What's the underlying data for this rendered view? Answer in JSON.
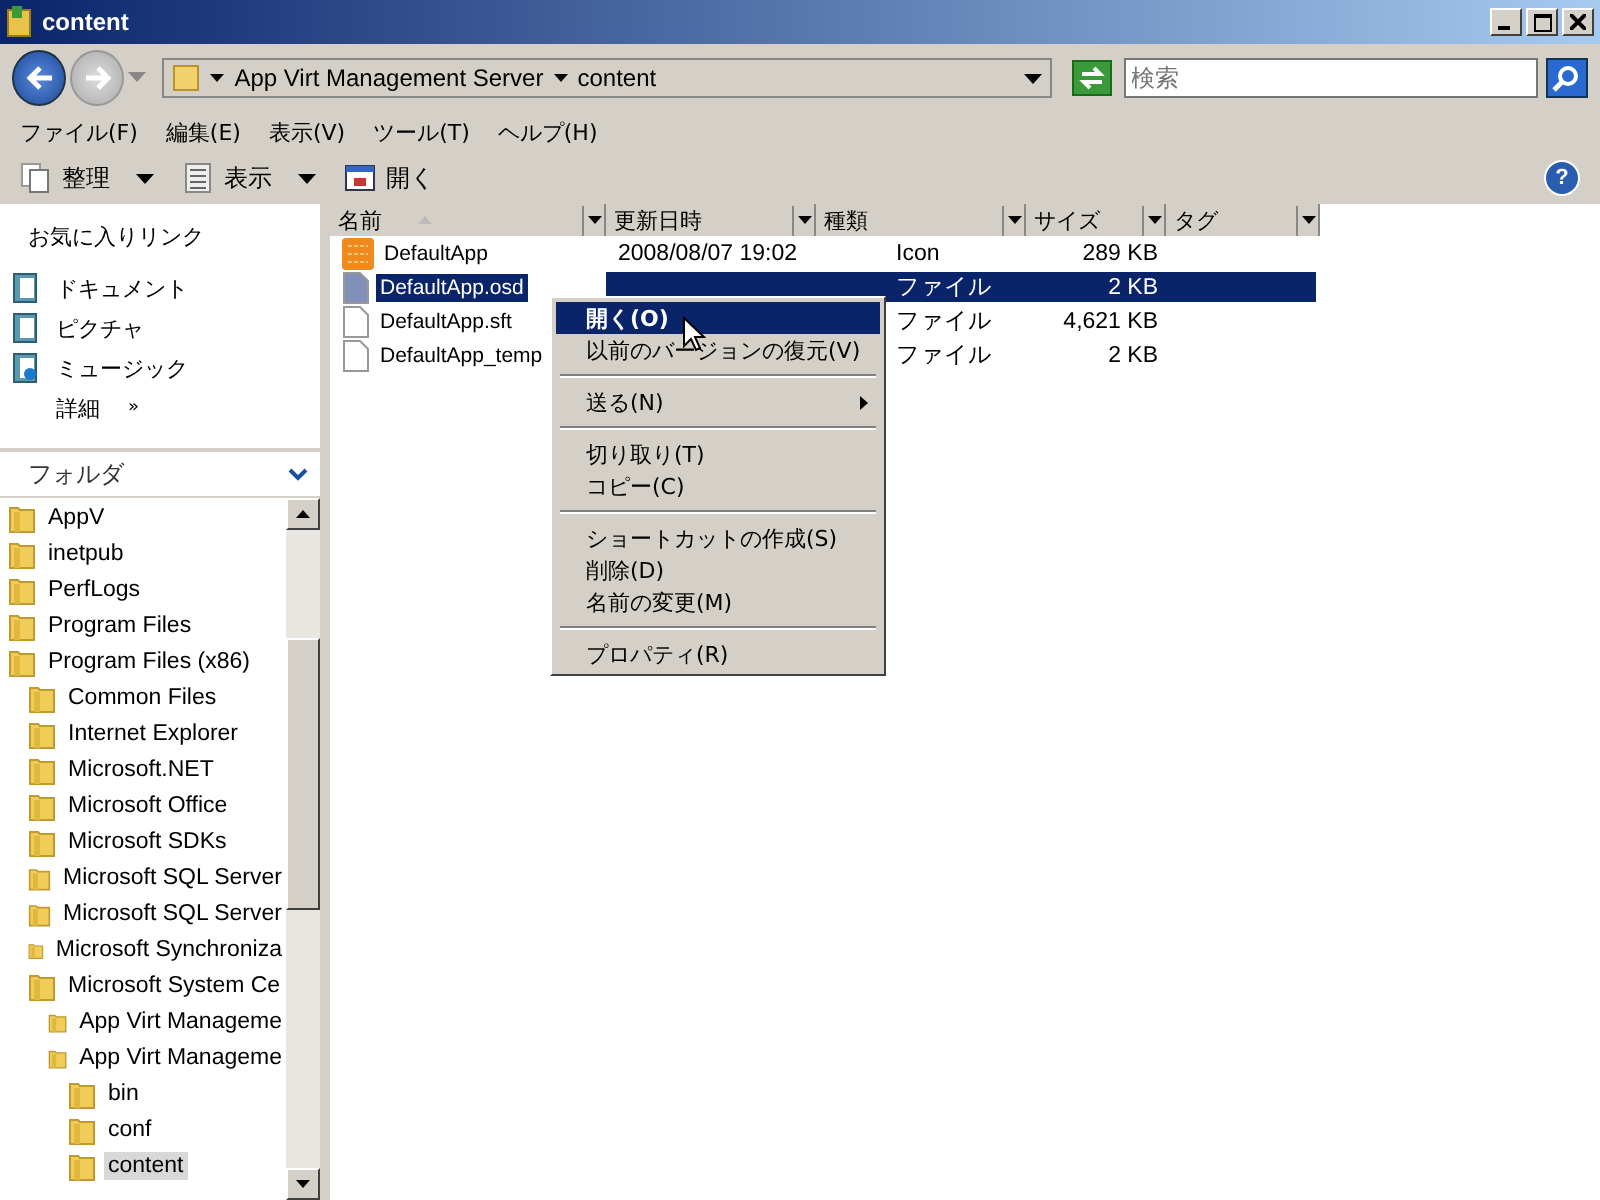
{
  "window": {
    "title": "content"
  },
  "address": {
    "segments": [
      "App Virt Management Server",
      "content"
    ]
  },
  "search": {
    "placeholder": "検索"
  },
  "help": {
    "glyph": "?"
  },
  "menubar": [
    "ファイル(F)",
    "編集(E)",
    "表示(V)",
    "ツール(T)",
    "ヘルプ(H)"
  ],
  "toolbar": [
    {
      "label": "整理",
      "dropdown": true
    },
    {
      "label": "表示",
      "dropdown": true
    },
    {
      "label": "開く",
      "dropdown": false
    }
  ],
  "favorites": {
    "title": "お気に入りリンク",
    "items": [
      "ドキュメント",
      "ピクチャ",
      "ミュージック"
    ],
    "more": "詳細",
    "more_glyph": "»"
  },
  "folders": {
    "title": "フォルダ",
    "tree": [
      {
        "name": "AppV",
        "selected": false
      },
      {
        "name": "inetpub",
        "selected": false
      },
      {
        "name": "PerfLogs",
        "selected": false
      },
      {
        "name": "Program Files",
        "selected": false
      },
      {
        "name": "Program Files (x86)",
        "selected": false,
        "children": [
          {
            "name": "Common Files",
            "selected": false
          },
          {
            "name": "Internet Explorer",
            "selected": false
          },
          {
            "name": "Microsoft.NET",
            "selected": false
          },
          {
            "name": "Microsoft Office",
            "selected": false
          },
          {
            "name": "Microsoft SDKs",
            "selected": false
          },
          {
            "name": "Microsoft SQL Server",
            "selected": false
          },
          {
            "name": "Microsoft SQL Server",
            "selected": false
          },
          {
            "name": "Microsoft Synchroniza",
            "selected": false
          },
          {
            "name": "Microsoft System Ce",
            "selected": false,
            "children": [
              {
                "name": "App Virt Manageme",
                "selected": false
              },
              {
                "name": "App Virt Manageme",
                "selected": false,
                "children": [
                  {
                    "name": "bin",
                    "selected": false
                  },
                  {
                    "name": "conf",
                    "selected": false
                  },
                  {
                    "name": "content",
                    "selected": true
                  }
                ]
              }
            ]
          }
        ]
      }
    ]
  },
  "columns": [
    "名前",
    "更新日時",
    "種類",
    "サイズ",
    "タグ"
  ],
  "files": [
    {
      "kind": "icon",
      "name": "DefaultApp",
      "date": "2008/08/07 19:02",
      "type": "Icon",
      "size": "289 KB",
      "selected": false
    },
    {
      "kind": "doc",
      "name": "DefaultApp.osd",
      "type": "ファイル",
      "size": "2 KB",
      "selected": true
    },
    {
      "kind": "doc",
      "name": "DefaultApp.sft",
      "type": "ファイル",
      "size": "4,621 KB",
      "selected": false
    },
    {
      "kind": "doc",
      "name": "DefaultApp_temp",
      "type": "ファイル",
      "size": "2 KB",
      "selected": false
    }
  ],
  "context_menu": [
    {
      "kind": "item",
      "label": "開く(O)",
      "default": true,
      "selected": true,
      "submenu": false
    },
    {
      "kind": "item",
      "label": "以前のバージョンの復元(V)",
      "default": false,
      "selected": false,
      "submenu": false
    },
    {
      "kind": "separator"
    },
    {
      "kind": "item",
      "label": "送る(N)",
      "default": false,
      "selected": false,
      "submenu": true
    },
    {
      "kind": "separator"
    },
    {
      "kind": "item",
      "label": "切り取り(T)",
      "default": false,
      "selected": false,
      "submenu": false
    },
    {
      "kind": "item",
      "label": "コピー(C)",
      "default": false,
      "selected": false,
      "submenu": false
    },
    {
      "kind": "separator"
    },
    {
      "kind": "item",
      "label": "ショートカットの作成(S)",
      "default": false,
      "selected": false,
      "submenu": false
    },
    {
      "kind": "item",
      "label": "削除(D)",
      "default": false,
      "selected": false,
      "submenu": false
    },
    {
      "kind": "item",
      "label": "名前の変更(M)",
      "default": false,
      "selected": false,
      "submenu": false
    },
    {
      "kind": "separator"
    },
    {
      "kind": "item",
      "label": "プロパティ(R)",
      "default": false,
      "selected": false,
      "submenu": false
    }
  ]
}
